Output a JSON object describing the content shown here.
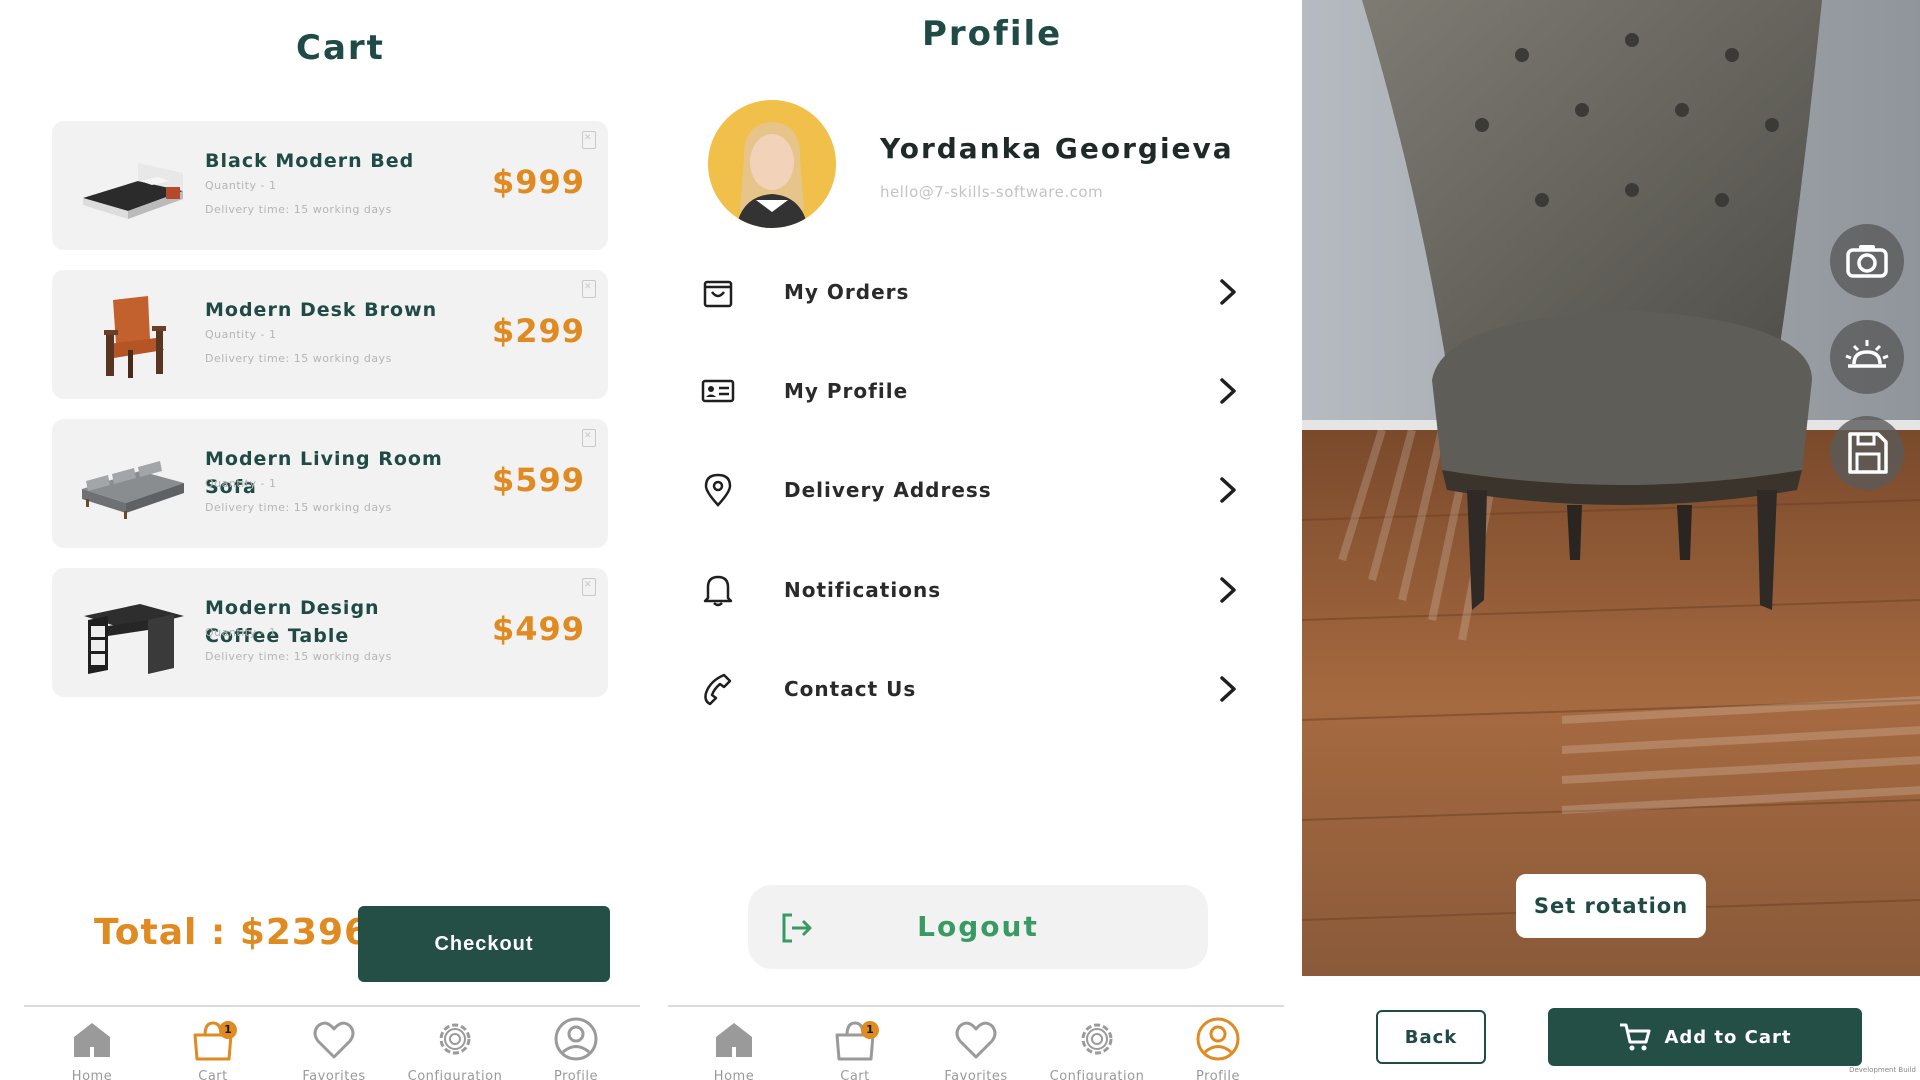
{
  "cart": {
    "title": "Cart",
    "items": [
      {
        "name": "Black Modern Bed",
        "quantity": "Quantity - 1",
        "delivery": "Delivery time: 15 working days",
        "price": "$999"
      },
      {
        "name": "Modern Desk Brown",
        "quantity": "Quantity - 1",
        "delivery": "Delivery time: 15 working days",
        "price": "$299"
      },
      {
        "name": "Modern Living Room Sofa",
        "quantity": "Quantity - 1",
        "delivery": "Delivery time: 15 working days",
        "price": "$599"
      },
      {
        "name": "Modern Design Coffee Table",
        "quantity": "Quantity - 1",
        "delivery": "Delivery time: 15 working days",
        "price": "$499"
      }
    ],
    "total": "Total : $2396",
    "checkout_label": "Checkout"
  },
  "nav": {
    "items": [
      {
        "label": "Home",
        "icon": "home-icon"
      },
      {
        "label": "Cart",
        "icon": "cart-icon",
        "badge": "1"
      },
      {
        "label": "Favorites",
        "icon": "heart-icon"
      },
      {
        "label": "Configuration",
        "icon": "gear-icon"
      },
      {
        "label": "Profile",
        "icon": "user-icon"
      }
    ],
    "active_color": "#e08a22",
    "inactive_color": "#9a9a9a"
  },
  "profile": {
    "title": "Profile",
    "name": "Yordanka Georgieva",
    "email": "hello@7-skills-software.com",
    "menu": [
      {
        "label": "My Orders",
        "icon": "shopping-bag-icon"
      },
      {
        "label": "My Profile",
        "icon": "id-card-icon"
      },
      {
        "label": "Delivery Address",
        "icon": "location-pin-icon"
      },
      {
        "label": "Notifications",
        "icon": "bell-icon"
      },
      {
        "label": "Contact Us",
        "icon": "phone-icon"
      }
    ],
    "logout_label": "Logout"
  },
  "ar": {
    "set_rotation_label": "Set rotation",
    "back_label": "Back",
    "add_to_cart_label": "Add to Cart",
    "side_buttons": [
      "camera-icon",
      "light-icon",
      "save-icon"
    ],
    "dev_build": "Development Build"
  },
  "colors": {
    "brand_dark": "#244f47",
    "accent_orange": "#e08a22",
    "logout_green": "#3a9a63"
  }
}
